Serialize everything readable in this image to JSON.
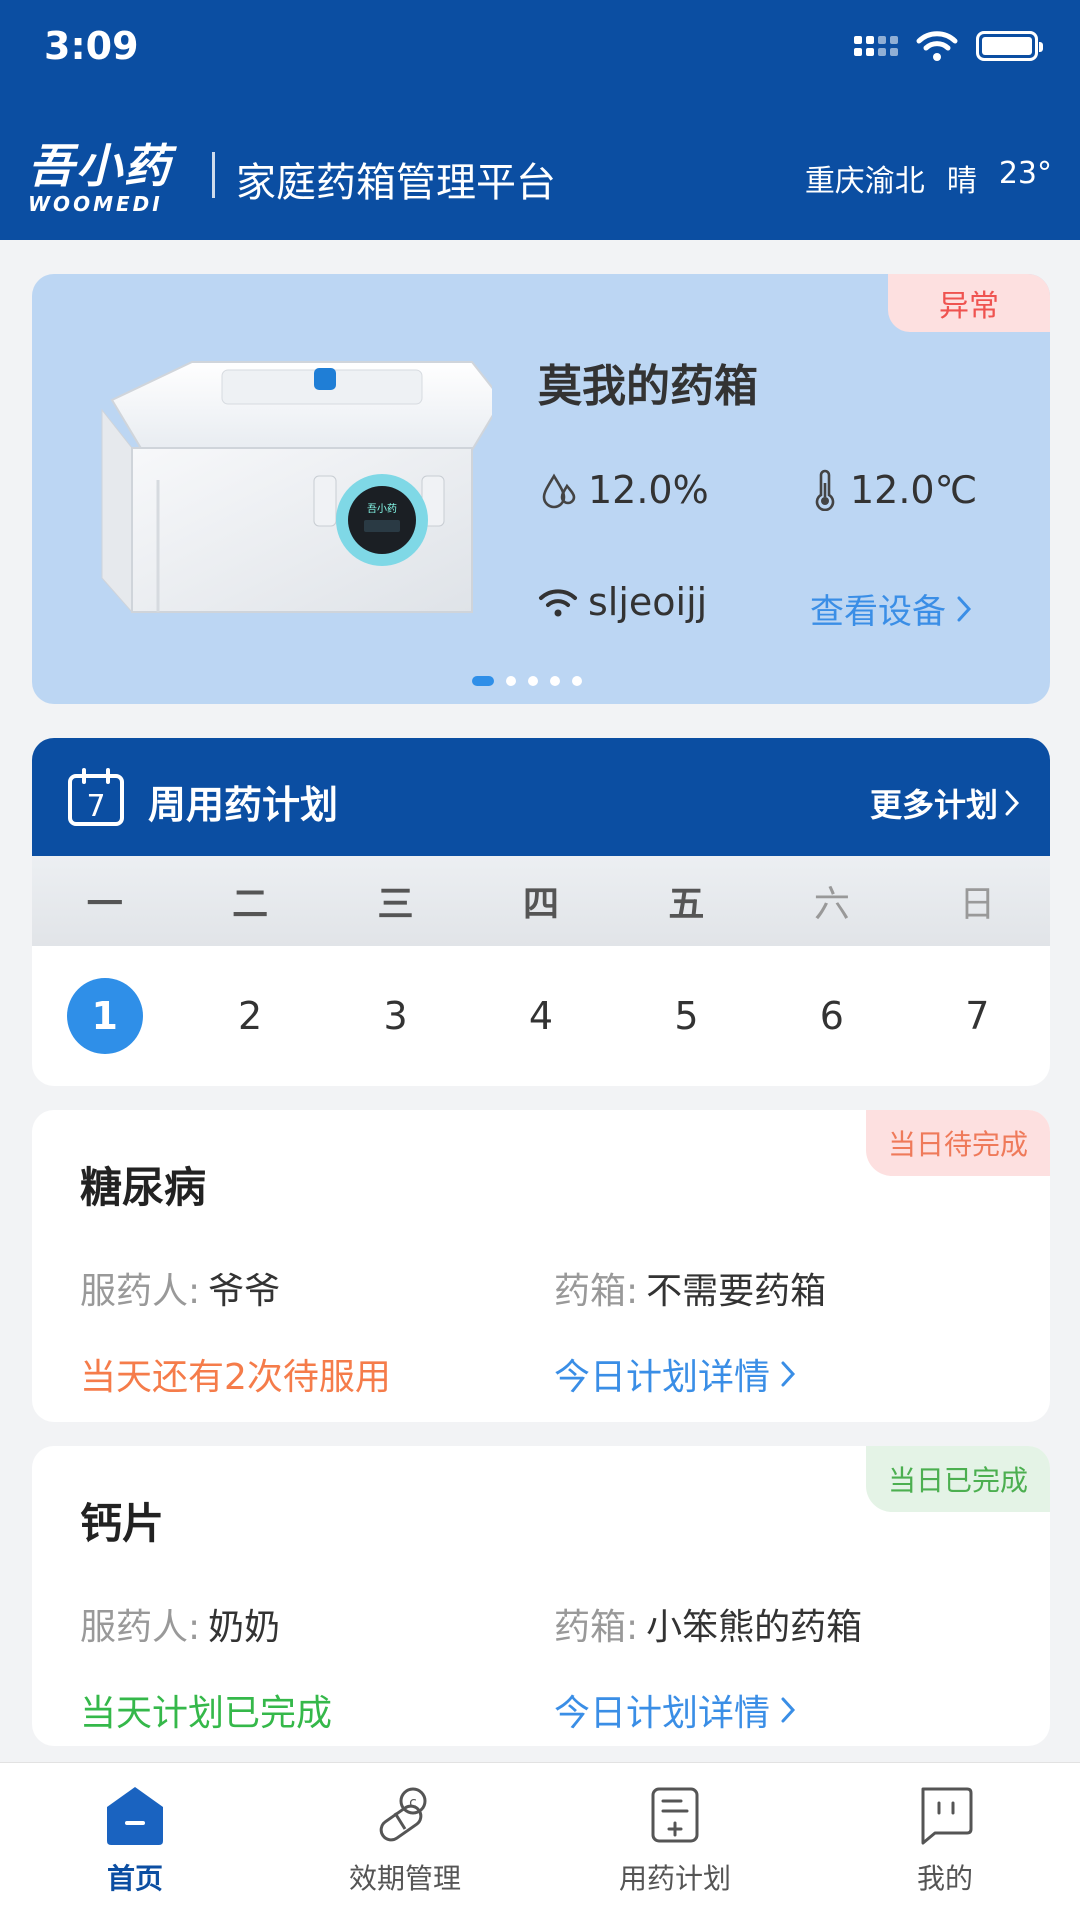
{
  "status_bar": {
    "time": "3:09"
  },
  "header": {
    "logo_cn": "吾小药",
    "logo_en": "WOOMEDI",
    "title": "家庭药箱管理平台",
    "location": "重庆渝北",
    "weather": "晴",
    "temperature": "23°"
  },
  "device": {
    "status_tag": "异常",
    "name": "莫我的药箱",
    "humidity": "12.0%",
    "temperature": "12.0℃",
    "wifi_name": "sljeoijj",
    "view_label": "查看设备",
    "page_count": 5,
    "page_index": 1
  },
  "weekly_plan": {
    "title": "周用药计划",
    "more_label": "更多计划",
    "calendar_icon_text": "7",
    "weekdays": [
      "一",
      "二",
      "三",
      "四",
      "五",
      "六",
      "日"
    ],
    "dates": [
      "1",
      "2",
      "3",
      "4",
      "5",
      "6",
      "7"
    ],
    "selected_date": "1"
  },
  "plans": [
    {
      "name": "糖尿病",
      "status": "当日待完成",
      "taker_label": "服药人:",
      "taker": "爷爷",
      "box_label": "药箱:",
      "box": "不需要药箱",
      "message": "当天还有2次待服用",
      "link_label": "今日计划详情"
    },
    {
      "name": "钙片",
      "status": "当日已完成",
      "taker_label": "服药人:",
      "taker": "奶奶",
      "box_label": "药箱:",
      "box": "小笨熊的药箱",
      "message": "当天计划已完成",
      "link_label": "今日计划详情"
    }
  ],
  "tabbar": {
    "items": [
      {
        "label": "首页",
        "icon": "home-icon",
        "active": true
      },
      {
        "label": "效期管理",
        "icon": "pills-icon",
        "active": false
      },
      {
        "label": "用药计划",
        "icon": "plan-icon",
        "active": false
      },
      {
        "label": "我的",
        "icon": "profile-icon",
        "active": false
      }
    ]
  },
  "colors": {
    "brand_blue": "#0b4ea2",
    "accent_blue": "#2f8fe8",
    "card_blue": "#bcd6f3",
    "alert_red": "#ef5350",
    "pending_orange": "#f57c4a",
    "done_green": "#35b84a"
  }
}
